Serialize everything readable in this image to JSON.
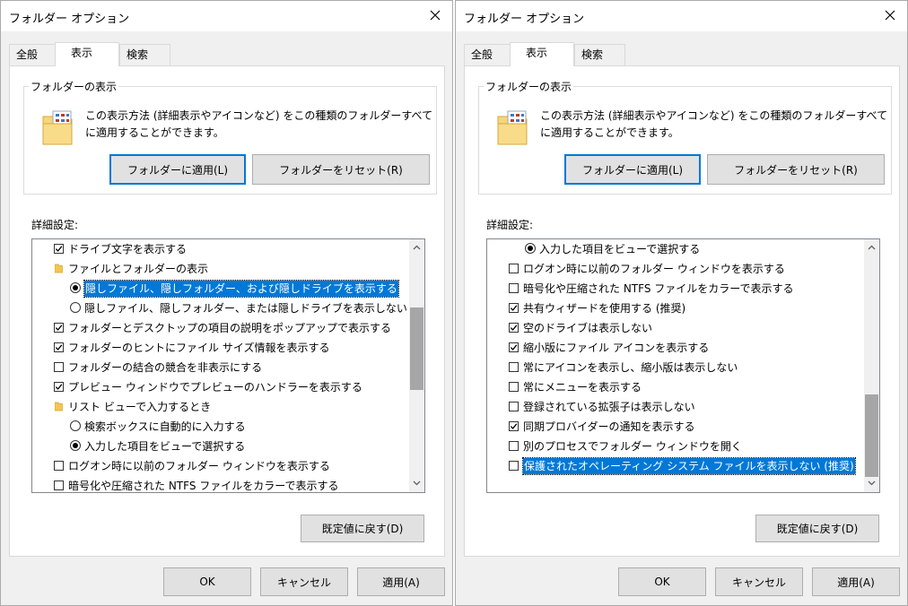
{
  "dialogs": [
    {
      "title": "フォルダー オプション",
      "tabs": [
        "全般",
        "表示",
        "検索"
      ],
      "active_tab": "表示",
      "group_label": "フォルダーの表示",
      "description": "この表示方法 (詳細表示やアイコンなど) をこの種類のフォルダーすべてに適用することができます。",
      "apply_folders": "フォルダーに適用(L)",
      "reset_folders": "フォルダーをリセット(R)",
      "advanced_label": "詳細設定:",
      "restore_defaults": "既定値に戻す(D)",
      "ok": "OK",
      "cancel": "キャンセル",
      "apply": "適用(A)",
      "items": [
        {
          "type": "checkbox",
          "checked": true,
          "level": 1,
          "label": "ドライブ文字を表示する",
          "selected": false
        },
        {
          "type": "folder",
          "level": 1,
          "label": "ファイルとフォルダーの表示",
          "selected": false
        },
        {
          "type": "radio",
          "checked": true,
          "level": 2,
          "label": "隠しファイル、隠しフォルダー、および隠しドライブを表示する",
          "selected": true
        },
        {
          "type": "radio",
          "checked": false,
          "level": 2,
          "label": "隠しファイル、隠しフォルダー、または隠しドライブを表示しない",
          "selected": false
        },
        {
          "type": "checkbox",
          "checked": true,
          "level": 1,
          "label": "フォルダーとデスクトップの項目の説明をポップアップで表示する",
          "selected": false
        },
        {
          "type": "checkbox",
          "checked": true,
          "level": 1,
          "label": "フォルダーのヒントにファイル サイズ情報を表示する",
          "selected": false
        },
        {
          "type": "checkbox",
          "checked": false,
          "level": 1,
          "label": "フォルダーの結合の競合を非表示にする",
          "selected": false
        },
        {
          "type": "checkbox",
          "checked": true,
          "level": 1,
          "label": "プレビュー ウィンドウでプレビューのハンドラーを表示する",
          "selected": false
        },
        {
          "type": "folder",
          "level": 1,
          "label": "リスト ビューで入力するとき",
          "selected": false
        },
        {
          "type": "radio",
          "checked": false,
          "level": 2,
          "label": "検索ボックスに自動的に入力する",
          "selected": false
        },
        {
          "type": "radio",
          "checked": true,
          "level": 2,
          "label": "入力した項目をビューで選択する",
          "selected": false
        },
        {
          "type": "checkbox",
          "checked": false,
          "level": 1,
          "label": "ログオン時に以前のフォルダー ウィンドウを表示する",
          "selected": false
        },
        {
          "type": "checkbox",
          "checked": false,
          "level": 1,
          "label": "暗号化や圧縮された NTFS ファイルをカラーで表示する",
          "selected": false
        }
      ],
      "scroll_position": 0.38
    },
    {
      "title": "フォルダー オプション",
      "tabs": [
        "全般",
        "表示",
        "検索"
      ],
      "active_tab": "表示",
      "group_label": "フォルダーの表示",
      "description": "この表示方法 (詳細表示やアイコンなど) をこの種類のフォルダーすべてに適用することができます。",
      "apply_folders": "フォルダーに適用(L)",
      "reset_folders": "フォルダーをリセット(R)",
      "advanced_label": "詳細設定:",
      "restore_defaults": "既定値に戻す(D)",
      "ok": "OK",
      "cancel": "キャンセル",
      "apply": "適用(A)",
      "items": [
        {
          "type": "radio",
          "checked": true,
          "level": 2,
          "label": "入力した項目をビューで選択する",
          "selected": false
        },
        {
          "type": "checkbox",
          "checked": false,
          "level": 1,
          "label": "ログオン時に以前のフォルダー ウィンドウを表示する",
          "selected": false
        },
        {
          "type": "checkbox",
          "checked": false,
          "level": 1,
          "label": "暗号化や圧縮された NTFS ファイルをカラーで表示する",
          "selected": false
        },
        {
          "type": "checkbox",
          "checked": true,
          "level": 1,
          "label": "共有ウィザードを使用する (推奨)",
          "selected": false
        },
        {
          "type": "checkbox",
          "checked": true,
          "level": 1,
          "label": "空のドライブは表示しない",
          "selected": false
        },
        {
          "type": "checkbox",
          "checked": true,
          "level": 1,
          "label": "縮小版にファイル アイコンを表示する",
          "selected": false
        },
        {
          "type": "checkbox",
          "checked": false,
          "level": 1,
          "label": "常にアイコンを表示し、縮小版は表示しない",
          "selected": false
        },
        {
          "type": "checkbox",
          "checked": false,
          "level": 1,
          "label": "常にメニューを表示する",
          "selected": false
        },
        {
          "type": "checkbox",
          "checked": false,
          "level": 1,
          "label": "登録されている拡張子は表示しない",
          "selected": false
        },
        {
          "type": "checkbox",
          "checked": true,
          "level": 1,
          "label": "同期プロバイダーの通知を表示する",
          "selected": false
        },
        {
          "type": "checkbox",
          "checked": false,
          "level": 1,
          "label": "別のプロセスでフォルダー ウィンドウを開く",
          "selected": false
        },
        {
          "type": "checkbox",
          "checked": false,
          "level": 1,
          "label": "保護されたオペレーティング システム ファイルを表示しない (推奨)",
          "selected": true
        }
      ],
      "scroll_position": 1.0
    }
  ],
  "colors": {
    "accent": "#0078d7",
    "face": "#f0f0f0",
    "button": "#e1e1e1",
    "thumb": "#a6a6a6"
  }
}
